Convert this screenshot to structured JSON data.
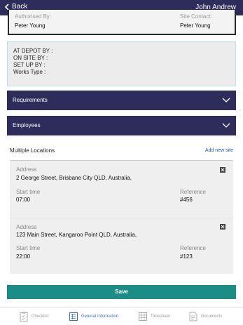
{
  "header": {
    "back_label": "Back",
    "user_name": "John Andrew"
  },
  "authorisation": {
    "authorised_by_label": "Authorised By:",
    "authorised_by_value": "Peter Young",
    "site_contact_label": "Site Contact:",
    "site_contact_value": "Peter Young"
  },
  "status_block": [
    "AT DEPOT BY :",
    "ON SITE BY :",
    "SET UP BY :",
    "Works Type :"
  ],
  "sections": {
    "requirements": "Requirements",
    "employees": "Employees"
  },
  "locations": {
    "title": "Multiple Locations",
    "add_label": "Add new site",
    "address_label": "Address",
    "start_time_label": "Start time",
    "reference_label": "Reference",
    "items": [
      {
        "address": "2 George Street, Brisbane City QLD, Australia,",
        "start_time": "07:00",
        "reference": "#456"
      },
      {
        "address": "123 Main Street, Kangaroo Point QLD, Australia,",
        "start_time": "22:00",
        "reference": "#123"
      }
    ]
  },
  "save_label": "Save",
  "tabs": [
    {
      "label": "Checklist",
      "icon": "checklist-icon",
      "active": false
    },
    {
      "label": "General Information",
      "icon": "list-icon",
      "active": true
    },
    {
      "label": "Timesheet",
      "icon": "timesheet-icon",
      "active": false
    },
    {
      "label": "Documents",
      "icon": "documents-icon",
      "active": false
    }
  ],
  "colors": {
    "header": "#2e2c5a",
    "accordion": "#2e2c5a",
    "save": "#1b8c86",
    "active_tab": "#3f6fb8",
    "link": "#2f4fa8"
  }
}
